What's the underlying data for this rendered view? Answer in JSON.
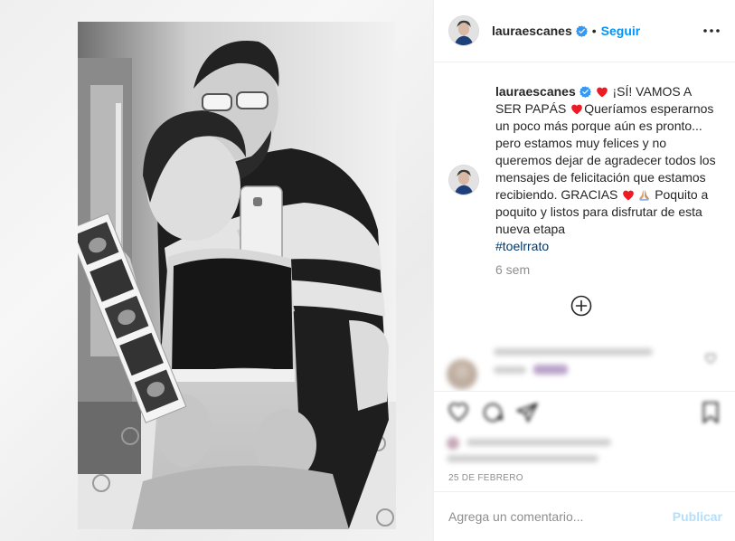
{
  "post": {
    "username": "lauraescanes",
    "follow_label": "Seguir",
    "separator": "•",
    "caption": {
      "username": "lauraescanes",
      "part1": "¡SÍ! VAMOS A SER PAPÁS",
      "part2": "Queríamos esperarnos un poco más porque aún es pronto... pero estamos muy felices y no queremos dejar de agradecer todos los mensajes de felicitación que estamos recibiendo. GRACIAS",
      "part3": "Poquito a poquito y listos para disfrutar de esta nueva etapa",
      "hashtag": "#toelrrato"
    },
    "time_ago": "6 sem",
    "date": "25 DE FEBRERO",
    "comment_placeholder": "Agrega un comentario...",
    "publish_label": "Publicar"
  },
  "colors": {
    "accent": "#0095f6",
    "heart": "#ed1c24",
    "verified": "#3897f0",
    "muted": "#8e8e8e",
    "publish_disabled": "#b2dffc"
  },
  "icons": {
    "more": "more-horizontal-icon",
    "verified": "verified-badge-icon",
    "heart": "red-heart-emoji-icon",
    "pray": "folded-hands-emoji-icon",
    "load_more": "plus-circle-icon",
    "like": "heart-outline-icon",
    "comment": "comment-bubble-icon",
    "share": "share-plane-icon",
    "save": "bookmark-icon"
  }
}
